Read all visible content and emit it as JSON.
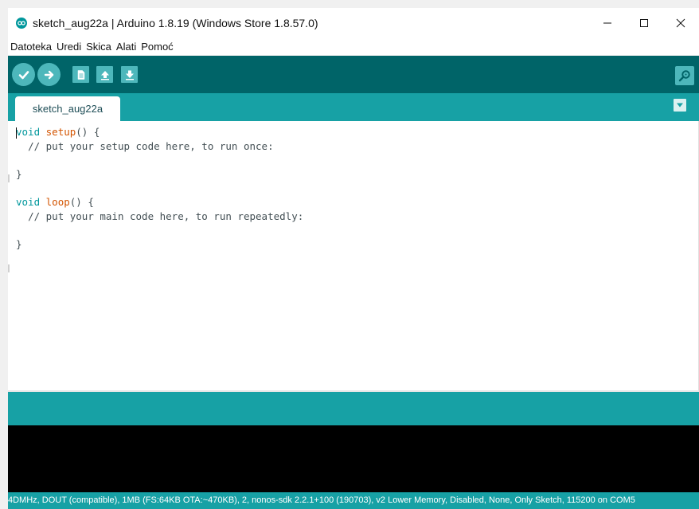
{
  "window": {
    "title": "sketch_aug22a | Arduino 1.8.19 (Windows Store 1.8.57.0)",
    "minimize_glyph": "—",
    "maximize_glyph": "☐",
    "close_glyph": "✕"
  },
  "menu": {
    "items": [
      "Datoteka",
      "Uredi",
      "Skica",
      "Alati",
      "Pomoć"
    ]
  },
  "toolbar": {
    "buttons": [
      {
        "name": "verify",
        "icon": "check-icon"
      },
      {
        "name": "upload",
        "icon": "arrow-right-icon"
      },
      {
        "name": "new",
        "icon": "document-icon"
      },
      {
        "name": "open",
        "icon": "arrow-up-icon"
      },
      {
        "name": "save",
        "icon": "arrow-down-icon"
      },
      {
        "name": "serial-monitor",
        "icon": "magnifier-icon"
      }
    ]
  },
  "tabs": {
    "active": "sketch_aug22a",
    "menu_icon": "triangle-down-icon"
  },
  "editor": {
    "lines": [
      "void setup() {",
      "  // put your setup code here, to run once:",
      "",
      "}",
      "",
      "void loop() {",
      "  // put your main code here, to run repeatedly:",
      "",
      "}"
    ]
  },
  "status": {
    "text": "4DMHz, DOUT (compatible), 1MB (FS:64KB OTA:~470KB), 2, nonos-sdk 2.2.1+100 (190703), v2 Lower Memory, Disabled, None, Only Sketch, 115200 on COM5"
  },
  "colors": {
    "toolbar": "#006468",
    "teal": "#17a1a5",
    "button": "#4db7bb",
    "keyword": "#00979c",
    "function": "#d35400",
    "console": "#000000"
  }
}
